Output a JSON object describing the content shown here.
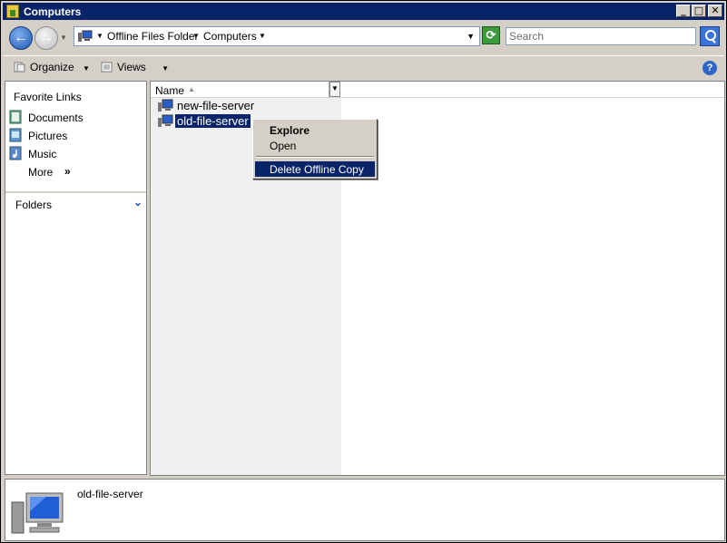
{
  "window": {
    "title": "Computers",
    "controls": {
      "minimize": "_",
      "maximize": "□",
      "close": "✕"
    }
  },
  "address": {
    "crumbs": [
      "Offline Files Folder",
      "Computers"
    ],
    "search_placeholder": "Search"
  },
  "toolbar": {
    "organize_label": "Organize",
    "views_label": "Views",
    "help_label": "?"
  },
  "nav": {
    "favorite_links_heading": "Favorite Links",
    "items": [
      {
        "label": "Documents",
        "icon": "documents-icon"
      },
      {
        "label": "Pictures",
        "icon": "pictures-icon"
      },
      {
        "label": "Music",
        "icon": "music-icon"
      },
      {
        "label": "More",
        "icon": "more-chevron-icon"
      }
    ],
    "folders_label": "Folders"
  },
  "files": {
    "column_name": "Name",
    "rows": [
      {
        "name": "new-file-server",
        "selected": false
      },
      {
        "name": "old-file-server",
        "selected": true
      }
    ]
  },
  "context_menu": {
    "items": [
      {
        "label": "Explore",
        "bold": true
      },
      {
        "label": "Open"
      },
      {
        "label": "Delete Offline Copy",
        "highlighted": true
      }
    ]
  },
  "details": {
    "name": "old-file-server"
  },
  "colors": {
    "titlebar": "#0a246a",
    "selection": "#0a246a",
    "chrome": "#d4d0c8"
  }
}
